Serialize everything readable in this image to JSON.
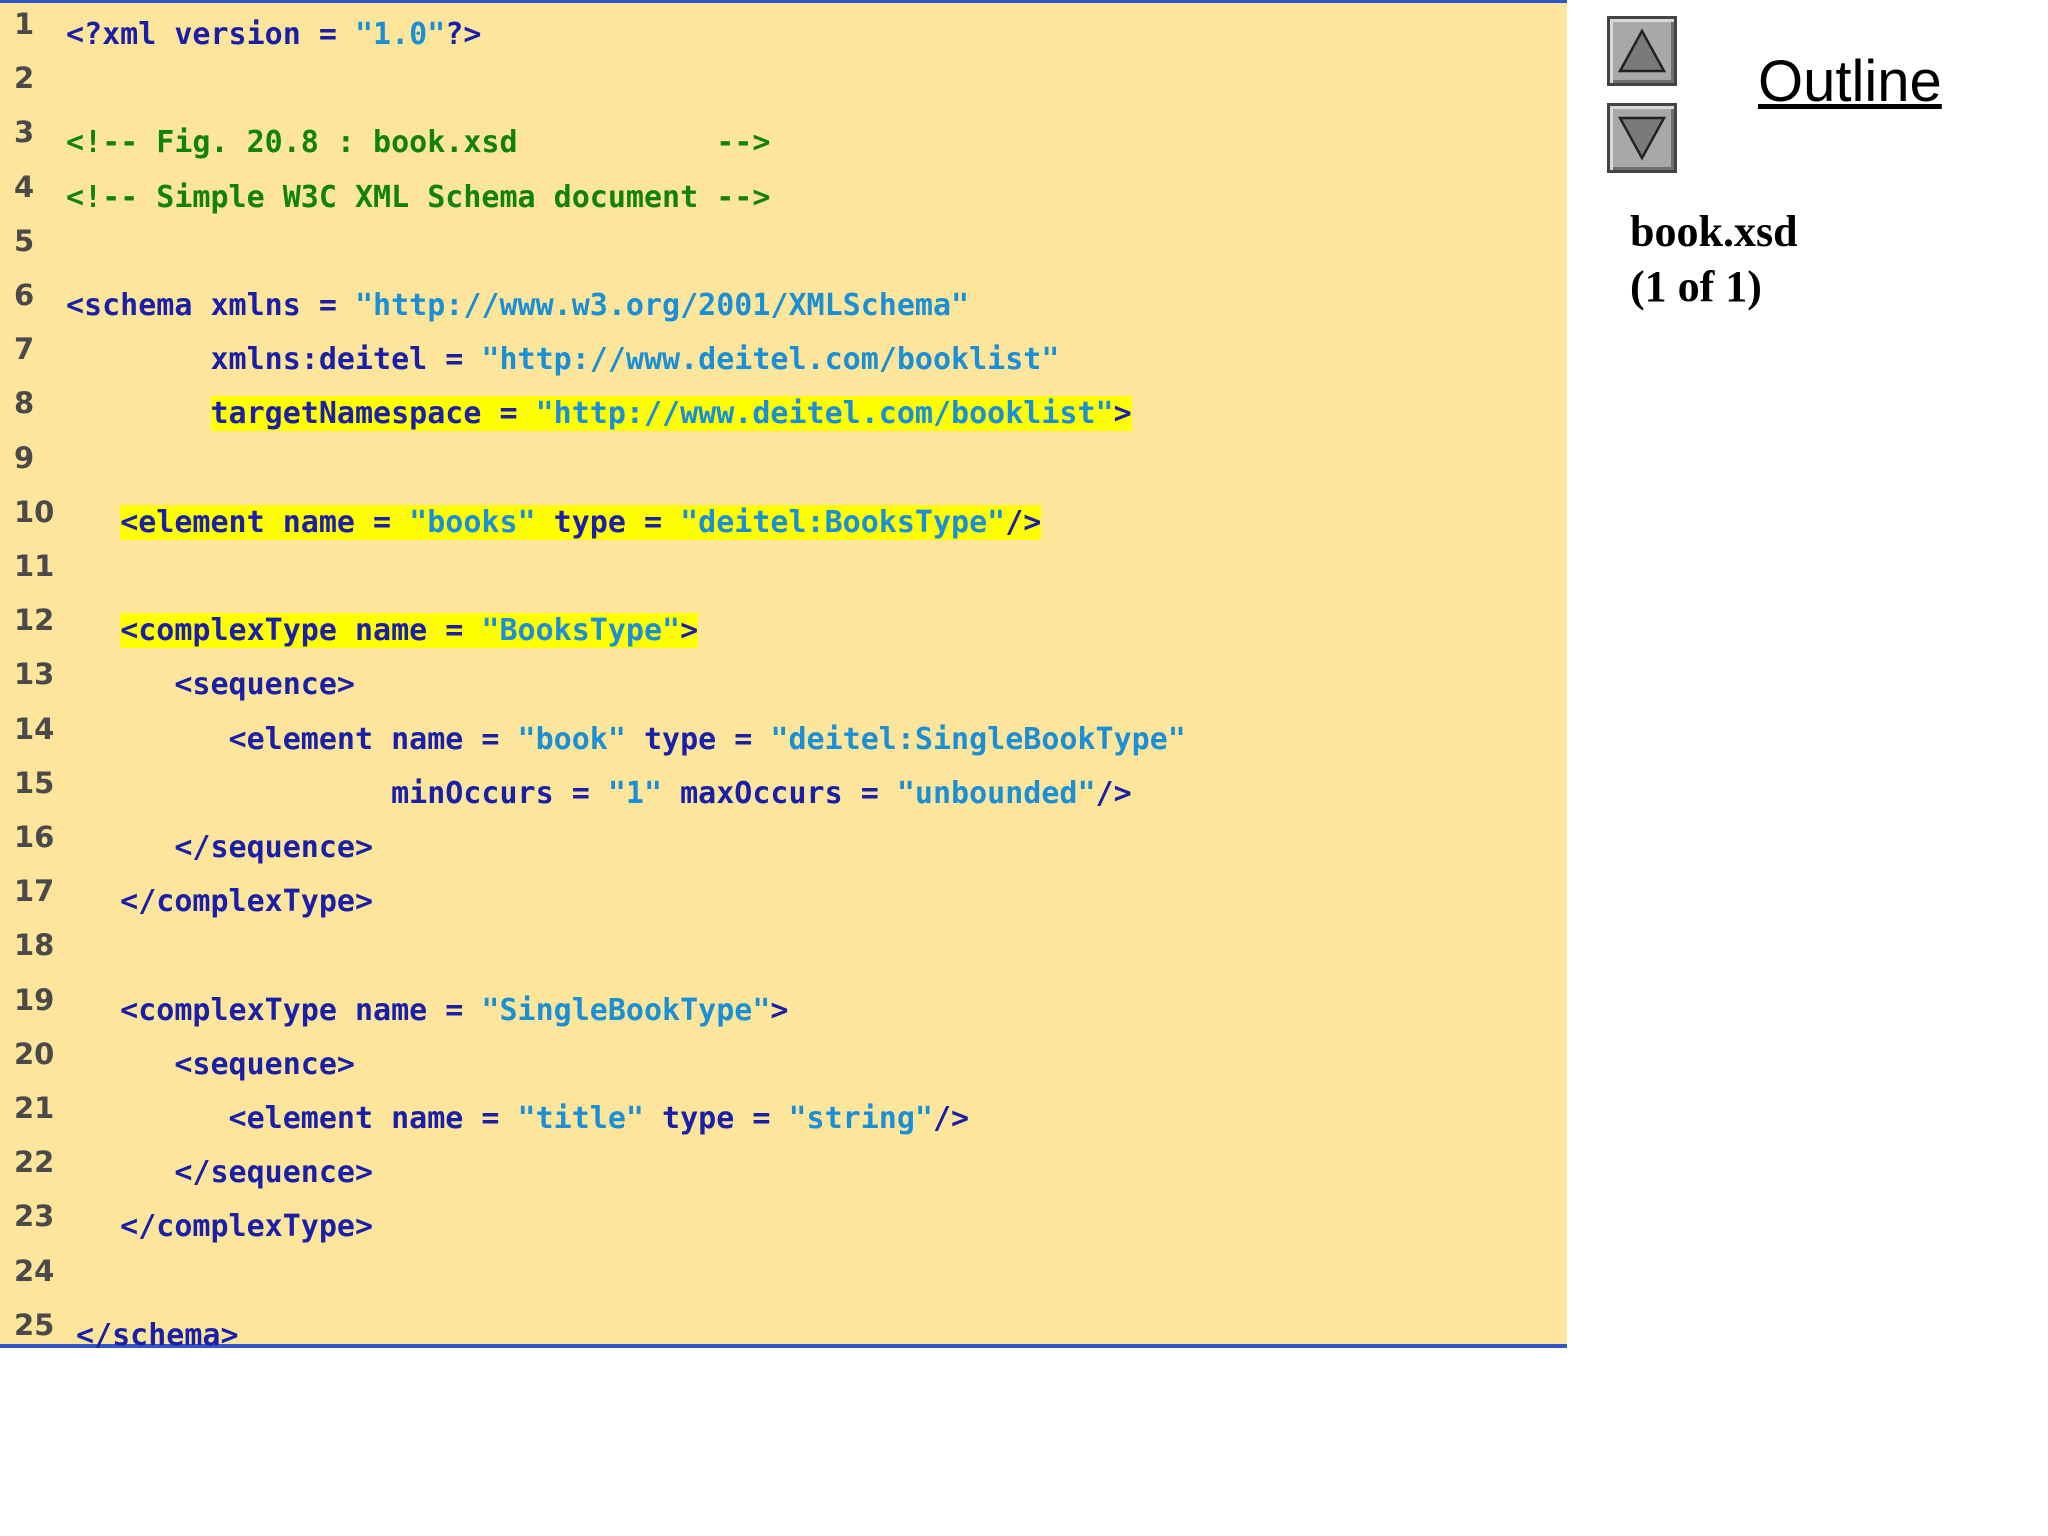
{
  "code": {
    "lines": [
      {
        "num": "1",
        "tokens": [
          {
            "t": "<?xml version = ",
            "c": "tag"
          },
          {
            "t": "\"1.0\"",
            "c": "str"
          },
          {
            "t": "?>",
            "c": "tag"
          }
        ]
      },
      {
        "num": "2",
        "tokens": []
      },
      {
        "num": "3",
        "tokens": [
          {
            "t": "<!-- Fig. 20.8 : book.xsd           -->",
            "c": "com"
          }
        ]
      },
      {
        "num": "4",
        "tokens": [
          {
            "t": "<!-- Simple W3C XML Schema document -->",
            "c": "com"
          }
        ]
      },
      {
        "num": "5",
        "tokens": []
      },
      {
        "num": "6",
        "tokens": [
          {
            "t": "<schema xmlns = ",
            "c": "tag"
          },
          {
            "t": "\"http://www.w3.org/2001/XMLSchema\"",
            "c": "str"
          }
        ]
      },
      {
        "num": "7",
        "tokens": [
          {
            "t": "        xmlns:deitel = ",
            "c": "tag"
          },
          {
            "t": "\"http://www.deitel.com/booklist\"",
            "c": "str"
          }
        ]
      },
      {
        "num": "8",
        "tokens": [
          {
            "t": "        ",
            "c": "tag"
          },
          {
            "t": "targetNamespace = ",
            "c": "tag",
            "hl": true
          },
          {
            "t": "\"http://www.deitel.com/booklist\"",
            "c": "str",
            "hl": true
          },
          {
            "t": ">",
            "c": "tag",
            "hl": true
          }
        ]
      },
      {
        "num": "9",
        "tokens": []
      },
      {
        "num": "10",
        "tokens": [
          {
            "t": "   ",
            "c": "tag"
          },
          {
            "t": "<element name = ",
            "c": "tag",
            "hl": true
          },
          {
            "t": "\"books\"",
            "c": "str",
            "hl": true
          },
          {
            "t": " type = ",
            "c": "tag",
            "hl": true
          },
          {
            "t": "\"deitel:BooksType\"",
            "c": "str",
            "hl": true
          },
          {
            "t": "/>",
            "c": "tag",
            "hl": true
          }
        ]
      },
      {
        "num": "11",
        "tokens": []
      },
      {
        "num": "12",
        "tokens": [
          {
            "t": "   ",
            "c": "tag"
          },
          {
            "t": "<complexType name = ",
            "c": "tag",
            "hl": true
          },
          {
            "t": "\"BooksType\"",
            "c": "str",
            "hl": true
          },
          {
            "t": ">",
            "c": "tag",
            "hl": true
          }
        ]
      },
      {
        "num": "13",
        "tokens": [
          {
            "t": "      <sequence>",
            "c": "tag"
          }
        ]
      },
      {
        "num": "14",
        "tokens": [
          {
            "t": "         <element name = ",
            "c": "tag"
          },
          {
            "t": "\"book\"",
            "c": "str"
          },
          {
            "t": " type = ",
            "c": "tag"
          },
          {
            "t": "\"deitel:SingleBookType\"",
            "c": "str"
          }
        ]
      },
      {
        "num": "15",
        "tokens": [
          {
            "t": "                  minOccurs = ",
            "c": "tag"
          },
          {
            "t": "\"1\"",
            "c": "str"
          },
          {
            "t": " maxOccurs = ",
            "c": "tag"
          },
          {
            "t": "\"unbounded\"",
            "c": "str"
          },
          {
            "t": "/>",
            "c": "tag"
          }
        ]
      },
      {
        "num": "16",
        "tokens": [
          {
            "t": "      </sequence>",
            "c": "tag"
          }
        ]
      },
      {
        "num": "17",
        "tokens": [
          {
            "t": "   </complexType>",
            "c": "tag"
          }
        ]
      },
      {
        "num": "18",
        "tokens": []
      },
      {
        "num": "19",
        "tokens": [
          {
            "t": "   <complexType name = ",
            "c": "tag"
          },
          {
            "t": "\"SingleBookType\"",
            "c": "str"
          },
          {
            "t": ">",
            "c": "tag"
          }
        ]
      },
      {
        "num": "20",
        "tokens": [
          {
            "t": "      <sequence>",
            "c": "tag"
          }
        ]
      },
      {
        "num": "21",
        "tokens": [
          {
            "t": "         <element name = ",
            "c": "tag"
          },
          {
            "t": "\"title\"",
            "c": "str"
          },
          {
            "t": " type = ",
            "c": "tag"
          },
          {
            "t": "\"string\"",
            "c": "str"
          },
          {
            "t": "/>",
            "c": "tag"
          }
        ]
      },
      {
        "num": "22",
        "tokens": [
          {
            "t": "      </sequence>",
            "c": "tag"
          }
        ]
      },
      {
        "num": "23",
        "tokens": [
          {
            "t": "   </complexType>",
            "c": "tag"
          }
        ]
      },
      {
        "num": "24",
        "tokens": []
      },
      {
        "num": "25",
        "tokens": [
          {
            "t": "</schema>",
            "c": "tag"
          }
        ]
      }
    ]
  },
  "sidebar": {
    "outline_label": "Outline",
    "file_name": "book.xsd",
    "page_count": "(1 of 1)",
    "nav_up_icon": "triangle-up-icon",
    "nav_down_icon": "triangle-down-icon"
  },
  "colors": {
    "panel_background": "#fde69b",
    "panel_border": "#3355cc",
    "tag": "#1a1fa8",
    "string": "#1a8fd6",
    "comment": "#12810f",
    "highlight": "#ffff00"
  }
}
